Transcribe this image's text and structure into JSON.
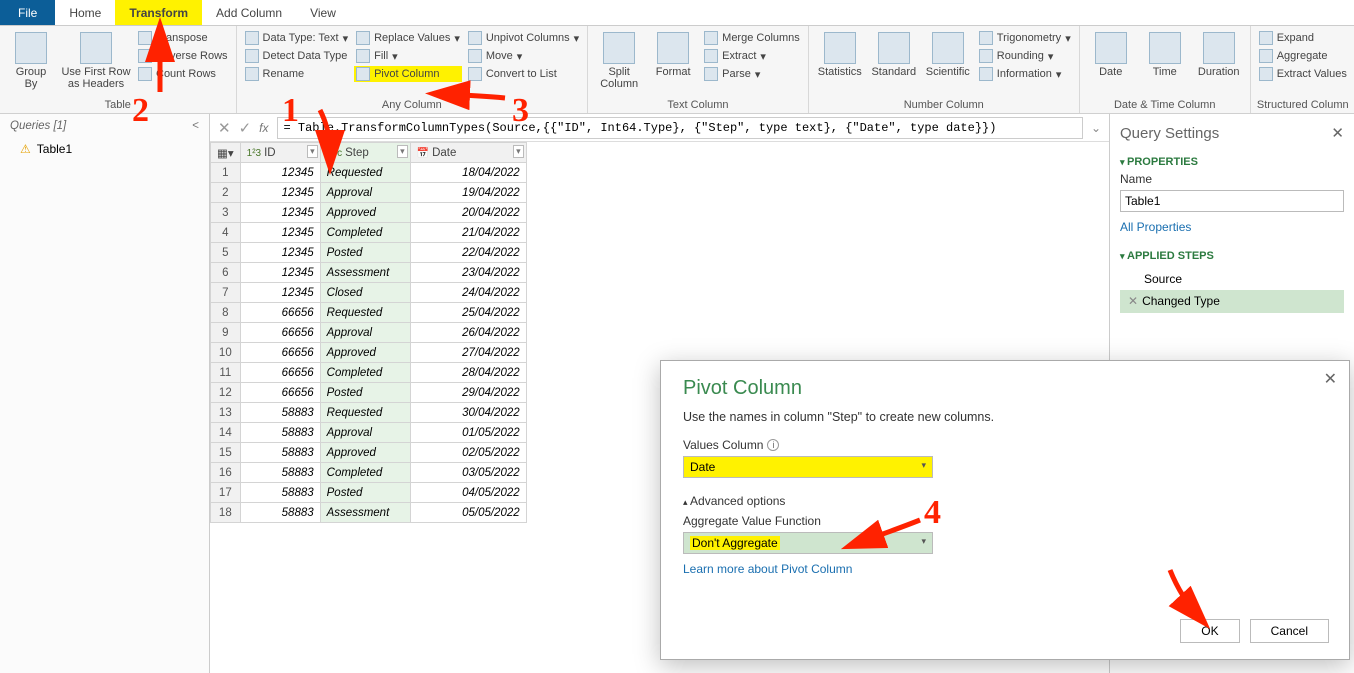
{
  "tabs": {
    "file": "File",
    "home": "Home",
    "transform": "Transform",
    "addcol": "Add Column",
    "view": "View"
  },
  "ribbon": {
    "table": {
      "groupby": "Group\nBy",
      "headers": "Use First Row\nas Headers",
      "transpose": "Transpose",
      "reverse": "Reverse Rows",
      "count": "Count Rows",
      "label": "Table"
    },
    "anycol": {
      "dtype": "Data Type: Text",
      "detect": "Detect Data Type",
      "rename": "Rename",
      "replace": "Replace Values",
      "fill": "Fill",
      "pivot": "Pivot Column",
      "unpivot": "Unpivot Columns",
      "move": "Move",
      "convert": "Convert to List",
      "label": "Any Column"
    },
    "textcol": {
      "split": "Split\nColumn",
      "format": "Format",
      "merge": "Merge Columns",
      "extract": "Extract",
      "parse": "Parse",
      "label": "Text Column"
    },
    "numcol": {
      "stats": "Statistics",
      "std": "Standard",
      "sci": "Scientific",
      "trig": "Trigonometry",
      "round": "Rounding",
      "info": "Information",
      "label": "Number Column"
    },
    "datecol": {
      "date": "Date",
      "time": "Time",
      "dur": "Duration",
      "label": "Date & Time Column"
    },
    "structcol": {
      "expand": "Expand",
      "agg": "Aggregate",
      "extract": "Extract Values",
      "label": "Structured Column"
    }
  },
  "queries": {
    "title": "Queries [1]",
    "item": "Table1"
  },
  "formula": "= Table.TransformColumnTypes(Source,{{\"ID\", Int64.Type}, {\"Step\", type text}, {\"Date\", type date}})",
  "columns": {
    "id": "ID",
    "step": "Step",
    "date": "Date"
  },
  "rows": [
    {
      "n": 1,
      "id": 12345,
      "step": "Requested",
      "date": "18/04/2022"
    },
    {
      "n": 2,
      "id": 12345,
      "step": "Approval",
      "date": "19/04/2022"
    },
    {
      "n": 3,
      "id": 12345,
      "step": "Approved",
      "date": "20/04/2022"
    },
    {
      "n": 4,
      "id": 12345,
      "step": "Completed",
      "date": "21/04/2022"
    },
    {
      "n": 5,
      "id": 12345,
      "step": "Posted",
      "date": "22/04/2022"
    },
    {
      "n": 6,
      "id": 12345,
      "step": "Assessment",
      "date": "23/04/2022"
    },
    {
      "n": 7,
      "id": 12345,
      "step": "Closed",
      "date": "24/04/2022"
    },
    {
      "n": 8,
      "id": 66656,
      "step": "Requested",
      "date": "25/04/2022"
    },
    {
      "n": 9,
      "id": 66656,
      "step": "Approval",
      "date": "26/04/2022"
    },
    {
      "n": 10,
      "id": 66656,
      "step": "Approved",
      "date": "27/04/2022"
    },
    {
      "n": 11,
      "id": 66656,
      "step": "Completed",
      "date": "28/04/2022"
    },
    {
      "n": 12,
      "id": 66656,
      "step": "Posted",
      "date": "29/04/2022"
    },
    {
      "n": 13,
      "id": 58883,
      "step": "Requested",
      "date": "30/04/2022"
    },
    {
      "n": 14,
      "id": 58883,
      "step": "Approval",
      "date": "01/05/2022"
    },
    {
      "n": 15,
      "id": 58883,
      "step": "Approved",
      "date": "02/05/2022"
    },
    {
      "n": 16,
      "id": 58883,
      "step": "Completed",
      "date": "03/05/2022"
    },
    {
      "n": 17,
      "id": 58883,
      "step": "Posted",
      "date": "04/05/2022"
    },
    {
      "n": 18,
      "id": 58883,
      "step": "Assessment",
      "date": "05/05/2022"
    }
  ],
  "settings": {
    "title": "Query Settings",
    "props": "PROPERTIES",
    "nameLabel": "Name",
    "nameValue": "Table1",
    "allProps": "All Properties",
    "steps": "APPLIED STEPS",
    "step1": "Source",
    "step2": "Changed Type"
  },
  "dialog": {
    "title": "Pivot Column",
    "desc": "Use the names in column \"Step\" to create new columns.",
    "valLabel": "Values Column",
    "valSel": "Date",
    "adv": "Advanced options",
    "aggLabel": "Aggregate Value Function",
    "aggSel": "Don't Aggregate",
    "learn": "Learn more about Pivot Column",
    "ok": "OK",
    "cancel": "Cancel"
  },
  "anno": {
    "a1": "1",
    "a2": "2",
    "a3": "3",
    "a4": "4"
  }
}
